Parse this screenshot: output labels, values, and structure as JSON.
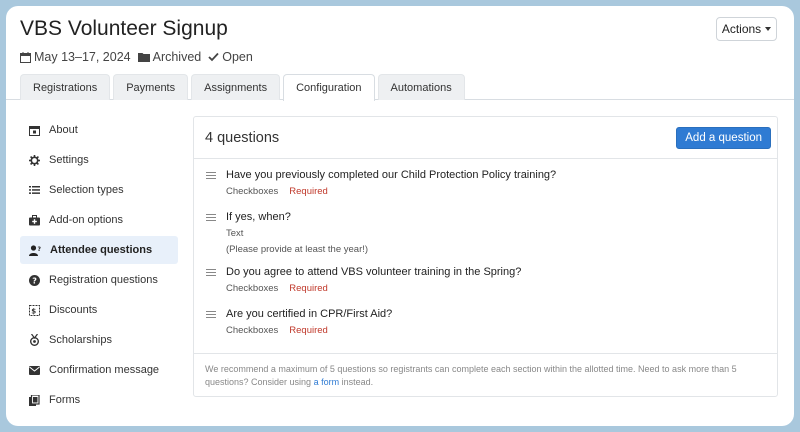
{
  "header": {
    "title": "VBS Volunteer Signup",
    "dates": "May 13–17, 2024",
    "archived_label": "Archived",
    "open_label": "Open",
    "actions_label": "Actions"
  },
  "tabs": [
    {
      "label": "Registrations",
      "active": false
    },
    {
      "label": "Payments",
      "active": false
    },
    {
      "label": "Assignments",
      "active": false
    },
    {
      "label": "Configuration",
      "active": true
    },
    {
      "label": "Automations",
      "active": false
    }
  ],
  "sidebar": {
    "items": [
      {
        "label": "About",
        "icon": "calendar-star-icon"
      },
      {
        "label": "Settings",
        "icon": "gear-icon"
      },
      {
        "label": "Selection types",
        "icon": "list-icon"
      },
      {
        "label": "Add-on options",
        "icon": "briefcase-plus-icon"
      },
      {
        "label": "Attendee questions",
        "icon": "user-question-icon",
        "active": true
      },
      {
        "label": "Registration questions",
        "icon": "question-circle-icon"
      },
      {
        "label": "Discounts",
        "icon": "discount-icon"
      },
      {
        "label": "Scholarships",
        "icon": "medal-icon"
      },
      {
        "label": "Confirmation message",
        "icon": "envelope-icon"
      },
      {
        "label": "Forms",
        "icon": "forms-icon"
      }
    ]
  },
  "panel": {
    "title": "4 questions",
    "add_button": "Add a question",
    "questions": [
      {
        "text": "Have you previously completed our Child Protection Policy training?",
        "type": "Checkboxes",
        "required": "Required"
      },
      {
        "text": "If yes, when?",
        "type": "Text",
        "note": "(Please provide at least the year!)"
      },
      {
        "text": "Do you agree to attend VBS volunteer training in the Spring?",
        "type": "Checkboxes",
        "required": "Required"
      },
      {
        "text": "Are you certified in CPR/First Aid?",
        "type": "Checkboxes",
        "required": "Required"
      }
    ],
    "footer_text_1": "We recommend a maximum of 5 questions so registrants can complete each section within the allotted time. Need to ask more than 5 questions? Consider using ",
    "footer_link": "a form",
    "footer_text_2": " instead."
  },
  "colors": {
    "accent": "#2f7bd3",
    "required": "#c0392b",
    "active_sidebar_bg": "#e8f0fa"
  }
}
